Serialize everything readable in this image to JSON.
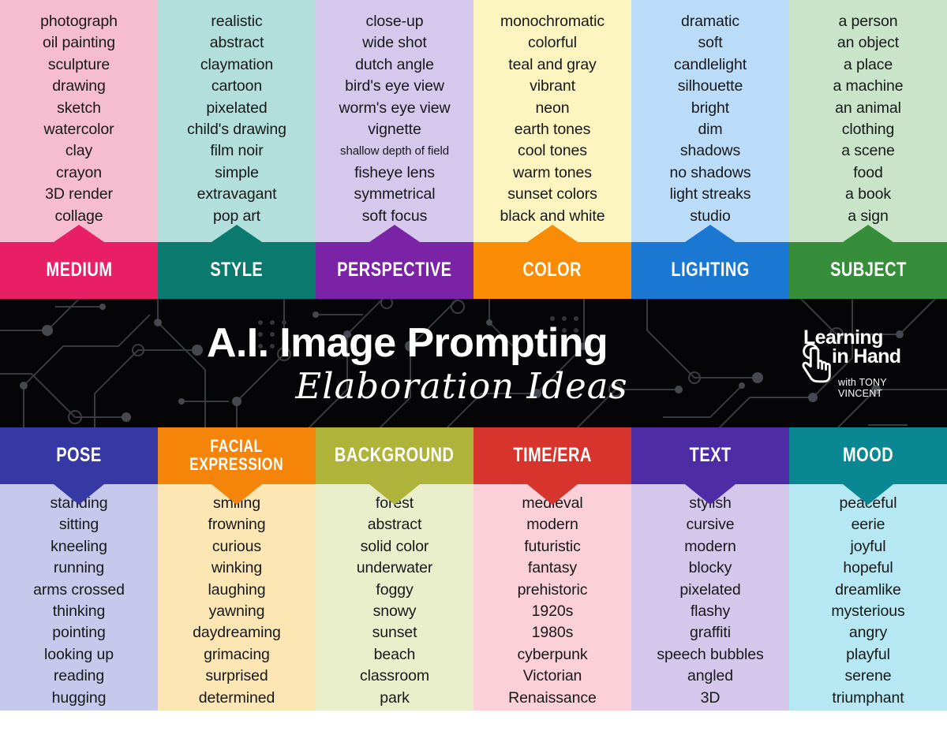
{
  "banner": {
    "title": "A.I. Image Prompting",
    "subtitle": "Elaboration Ideas",
    "logo_line1": "Learning",
    "logo_line2": "in Hand",
    "logo_line3": "with TONY VINCENT",
    "background_color": "#050507",
    "circuit_color": "#3a3d42"
  },
  "top_columns": [
    {
      "label": "MEDIUM",
      "band_color": "#E81F64",
      "tint_color": "#F6BCD0",
      "words": [
        "photograph",
        "oil painting",
        "sculpture",
        "drawing",
        "sketch",
        "watercolor",
        "clay",
        "crayon",
        "3D render",
        "collage"
      ]
    },
    {
      "label": "STYLE",
      "band_color": "#0A7A6E",
      "tint_color": "#B2DFDB",
      "words": [
        "realistic",
        "abstract",
        "claymation",
        "cartoon",
        "pixelated",
        "child's drawing",
        "film noir",
        "simple",
        "extravagant",
        "pop art"
      ]
    },
    {
      "label": "PERSPECTIVE",
      "band_color": "#7B23A7",
      "tint_color": "#D5C8EC",
      "words": [
        "close-up",
        "wide shot",
        "dutch angle",
        "bird's eye view",
        "worm's eye view",
        "vignette",
        "shallow depth of field",
        "fisheye lens",
        "symmetrical",
        "soft focus"
      ],
      "small_words": [
        "shallow depth of field"
      ]
    },
    {
      "label": "COLOR",
      "band_color": "#FA8C05",
      "tint_color": "#FCF5C0",
      "words": [
        "monochromatic",
        "colorful",
        "teal and gray",
        "vibrant",
        "neon",
        "earth tones",
        "cool tones",
        "warm tones",
        "sunset colors",
        "black and white"
      ]
    },
    {
      "label": "LIGHTING",
      "band_color": "#1A78D2",
      "tint_color": "#BBDCF8",
      "words": [
        "dramatic",
        "soft",
        "candlelight",
        "silhouette",
        "bright",
        "dim",
        "shadows",
        "no shadows",
        "light streaks",
        "studio"
      ]
    },
    {
      "label": "SUBJECT",
      "band_color": "#378E3A",
      "tint_color": "#C9E4C9",
      "words": [
        "a person",
        "an object",
        "a place",
        "a machine",
        "an animal",
        "clothing",
        "a scene",
        "food",
        "a book",
        "a sign"
      ]
    }
  ],
  "bottom_columns": [
    {
      "label": "POSE",
      "band_color": "#3639A3",
      "tint_color": "#C6C9EC",
      "words": [
        "standing",
        "sitting",
        "kneeling",
        "running",
        "arms crossed",
        "thinking",
        "pointing",
        "looking up",
        "reading",
        "hugging"
      ]
    },
    {
      "label": "FACIAL\nEXPRESSION",
      "band_color": "#F5850A",
      "tint_color": "#FBE6B4",
      "two_line": true,
      "words": [
        "smiling",
        "frowning",
        "curious",
        "winking",
        "laughing",
        "yawning",
        "daydreaming",
        "grimacing",
        "surprised",
        "determined"
      ]
    },
    {
      "label": "BACKGROUND",
      "band_color": "#AFB33A",
      "tint_color": "#E8EFCA",
      "words": [
        "forest",
        "abstract",
        "solid color",
        "underwater",
        "foggy",
        "snowy",
        "sunset",
        "beach",
        "classroom",
        "park"
      ]
    },
    {
      "label": "TIME/ERA",
      "band_color": "#D8342E",
      "tint_color": "#FBD0D9",
      "words": [
        "medieval",
        "modern",
        "futuristic",
        "fantasy",
        "prehistoric",
        "1920s",
        "1980s",
        "cyberpunk",
        "Victorian",
        "Renaissance"
      ]
    },
    {
      "label": "TEXT",
      "band_color": "#4E2CA5",
      "tint_color": "#D5C6EC",
      "words": [
        "stylish",
        "cursive",
        "modern",
        "blocky",
        "pixelated",
        "flashy",
        "graffiti",
        "speech bubbles",
        "angled",
        "3D"
      ]
    },
    {
      "label": "MOOD",
      "band_color": "#0B8794",
      "tint_color": "#B5E8F2",
      "words": [
        "peaceful",
        "eerie",
        "joyful",
        "hopeful",
        "dreamlike",
        "mysterious",
        "angry",
        "playful",
        "serene",
        "triumphant"
      ]
    }
  ]
}
